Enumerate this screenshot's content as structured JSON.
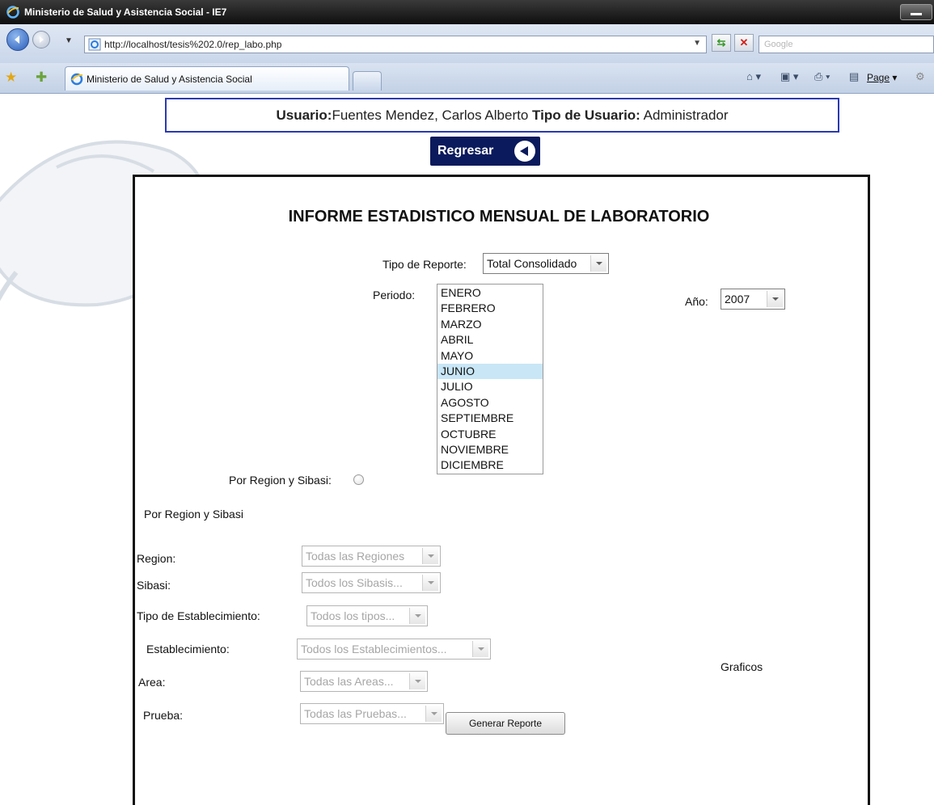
{
  "browser": {
    "window_title": "Ministerio de Salud y Asistencia Social - IE7",
    "url": "http://localhost/tesis%202.0/rep_labo.php",
    "search_placeholder": "Google",
    "tab_title": "Ministerio de Salud y Asistencia Social",
    "page_menu_label": "Page"
  },
  "header": {
    "usuario_label": "Usuario:",
    "usuario_value": "Fuentes Mendez, Carlos Alberto",
    "tipo_label": "Tipo de Usuario:",
    "tipo_value": "Administrador",
    "back_button": "Regresar"
  },
  "form": {
    "title": "INFORME ESTADISTICO MENSUAL DE LABORATORIO",
    "tipo_reporte_label": "Tipo de Reporte:",
    "tipo_reporte_value": "Total Consolidado",
    "periodo_label": "Periodo:",
    "months": [
      "ENERO",
      "FEBRERO",
      "MARZO",
      "ABRIL",
      "MAYO",
      "JUNIO",
      "JULIO",
      "AGOSTO",
      "SEPTIEMBRE",
      "OCTUBRE",
      "NOVIEMBRE",
      "DICIEMBRE"
    ],
    "selected_month": "JUNIO",
    "anio_label": "Año:",
    "anio_value": "2007",
    "radio_label": "Por Region y Sibasi:",
    "section_heading": "Por Region y Sibasi",
    "region_label": "Region:",
    "region_value": "Todas las Regiones",
    "sibasi_label": "Sibasi:",
    "sibasi_value": "Todos los Sibasis...",
    "tipo_est_label": "Tipo de Establecimiento:",
    "tipo_est_value": "Todos los tipos...",
    "establecimiento_label": "Establecimiento:",
    "establecimiento_value": "Todos los Establecimientos...",
    "area_label": "Area:",
    "area_value": "Todas las Areas...",
    "prueba_label": "Prueba:",
    "prueba_value": "Todas las Pruebas...",
    "graficos_label": "Graficos",
    "generate_button": "Generar Reporte"
  }
}
